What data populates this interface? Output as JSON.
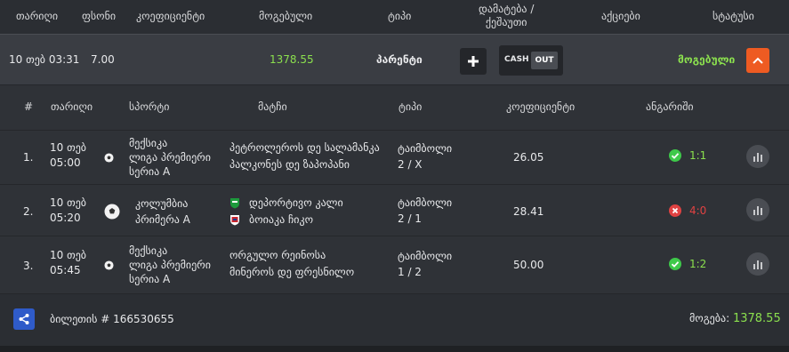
{
  "top_header": {
    "date": "თარიღი",
    "bonus": "ფსონი",
    "coefficient": "კოეფიციენტი",
    "win": "მოგებული",
    "type": "ტიპი",
    "type2_line1": "დამატება /",
    "type2_line2": "ქეშაუთი",
    "actions": "აქციები",
    "status": "სტატუსი"
  },
  "bet": {
    "date": "10 თებ 03:31",
    "stake": "7.00",
    "win_amount": "1378.55",
    "type": "პარენტი",
    "cash_label": "CASH",
    "out_label": "OUT",
    "status": "მოგებული"
  },
  "detail_header": {
    "num": "#",
    "date": "თარიღი",
    "sport": "სპორტი",
    "match": "მატჩი",
    "type": "ტიპი",
    "coefficient": "კოეფიციენტი",
    "score": "ანგარიში"
  },
  "rows": [
    {
      "num": "1.",
      "date1": "10 თებ",
      "date2": "05:00",
      "league1": "მექსიკა",
      "league2": "ლიგა პრემიერი",
      "league3": "სერია A",
      "team1": "პეტროლეროს დე სალამანკა",
      "team2": "პალკონეს დე ზაპოპანი",
      "type1": "ტაიმბოლი",
      "type2": "2 / X",
      "odds": "26.05",
      "score": "1:1",
      "result": "win"
    },
    {
      "num": "2.",
      "date1": "10 თებ",
      "date2": "05:20",
      "league1": "კოლუმბია",
      "league2": "პრიმერა A",
      "team1": "დეპორტივო კალი",
      "team2": "ბოიაკა ჩიკო",
      "type1": "ტაიმბოლი",
      "type2": "2 / 1",
      "odds": "28.41",
      "score": "4:0",
      "result": "loss"
    },
    {
      "num": "3.",
      "date1": "10 თებ",
      "date2": "05:45",
      "league1": "მექსიკა",
      "league2": "ლიგა პრემიერი",
      "league3": "სერია A",
      "team1": "ორგულო რეინოსა",
      "team2": "მინეროს დე ფრესნილო",
      "type1": "ტაიმბოლი",
      "type2": "1 / 2",
      "odds": "50.00",
      "score": "1:2",
      "result": "win"
    }
  ],
  "footer": {
    "ticket": "ბილეთის # 166530655",
    "win_label": "მოგება:",
    "win_value": "1378.55"
  },
  "colors": {
    "win_green": "#8be04e",
    "loss_red": "#e04242",
    "accent_orange": "#ee5b22",
    "share_blue": "#2f5bc9"
  },
  "icons": [
    "plus-icon",
    "chevron-up-icon",
    "soccer-ball-icon",
    "check-circle-icon",
    "x-circle-icon",
    "bar-chart-icon",
    "share-icon",
    "team-crest-icon"
  ]
}
